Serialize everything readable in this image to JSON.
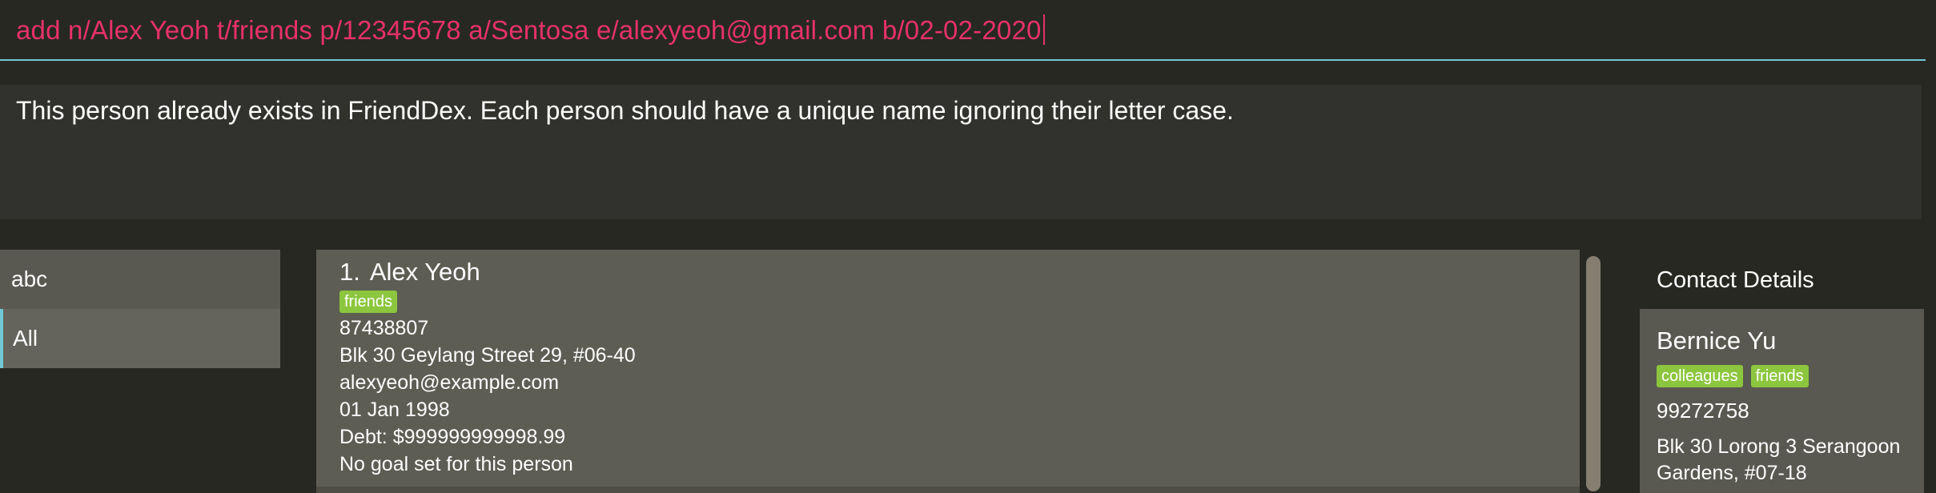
{
  "command_box": {
    "text": "add n/Alex Yeoh t/friends p/12345678 a/Sentosa e/alexyeoh@gmail.com b/02-02-2020"
  },
  "result_box": {
    "text": "This person already exists in FriendDex. Each person should have a unique name ignoring their letter case."
  },
  "group_list": {
    "items": [
      {
        "label": "abc"
      },
      {
        "label": "All"
      }
    ]
  },
  "person_list": {
    "persons": [
      {
        "index": "1.",
        "name": "Alex Yeoh",
        "tags": [
          "friends"
        ],
        "phone": "87438807",
        "address": "Blk 30 Geylang Street 29, #06-40",
        "email": "alexyeoh@example.com",
        "birthday": "01 Jan 1998",
        "debt": "Debt: $999999999998.99",
        "goal": "No goal set for this person"
      }
    ]
  },
  "contact_details": {
    "header": "Contact Details",
    "name": "Bernice Yu",
    "tags": [
      "colleagues",
      "friends"
    ],
    "phone": "99272758",
    "address": "Blk 30 Lorong 3 Serangoon Gardens, #07-18"
  },
  "colors": {
    "background": "#272822",
    "command_text": "#e8316a",
    "command_underline": "#6fc8d6",
    "tag": "#8cc63e",
    "card": "#5d5d54"
  }
}
